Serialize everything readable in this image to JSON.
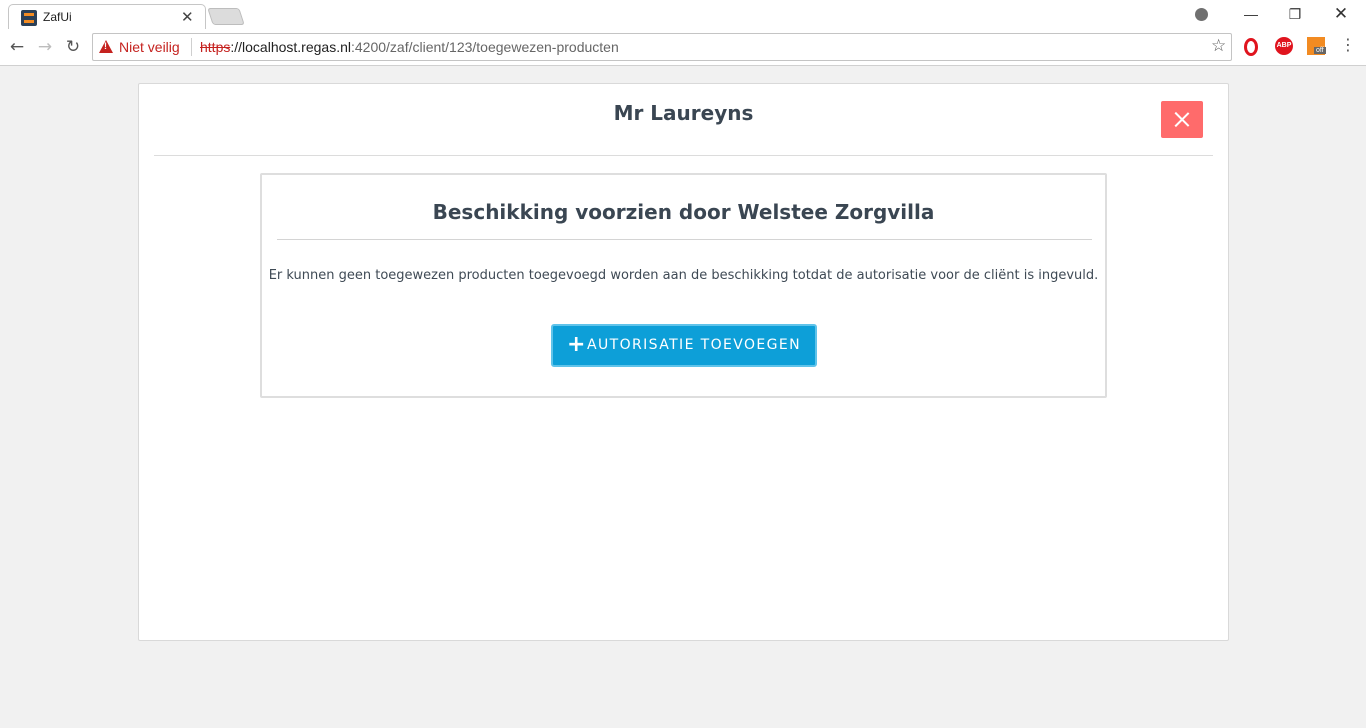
{
  "browser": {
    "tab": {
      "title": "ZafUi",
      "close": "✕"
    },
    "window_controls": {
      "minimize": "—",
      "maximize": "❐",
      "close": "✕"
    },
    "nav": {
      "back": "←",
      "forward": "→",
      "reload": "↻"
    },
    "security_label": "Niet veilig",
    "url": {
      "scheme": "https",
      "separator": "://",
      "host": "localhost.regas.nl",
      "path": ":4200/zaf/client/123/toegewezen-producten"
    },
    "extensions": {
      "abp_label": "ABP",
      "off_label": "off"
    },
    "menu": "⋮",
    "star": "☆"
  },
  "page": {
    "title": "Mr Laureyns",
    "panel": {
      "title": "Beschikking voorzien door Welstee Zorgvilla",
      "message": "Er kunnen geen toegewezen producten toegevoegd worden aan de beschikking totdat de autorisatie voor de cliënt is ingevuld.",
      "button_icon": "+",
      "button_label": "AUTORISATIE TOEVOEGEN"
    }
  },
  "colors": {
    "close_button": "#ff6b6b",
    "primary_button": "#0d9fd8",
    "warning": "#c5221f",
    "heading": "#3a4652"
  }
}
